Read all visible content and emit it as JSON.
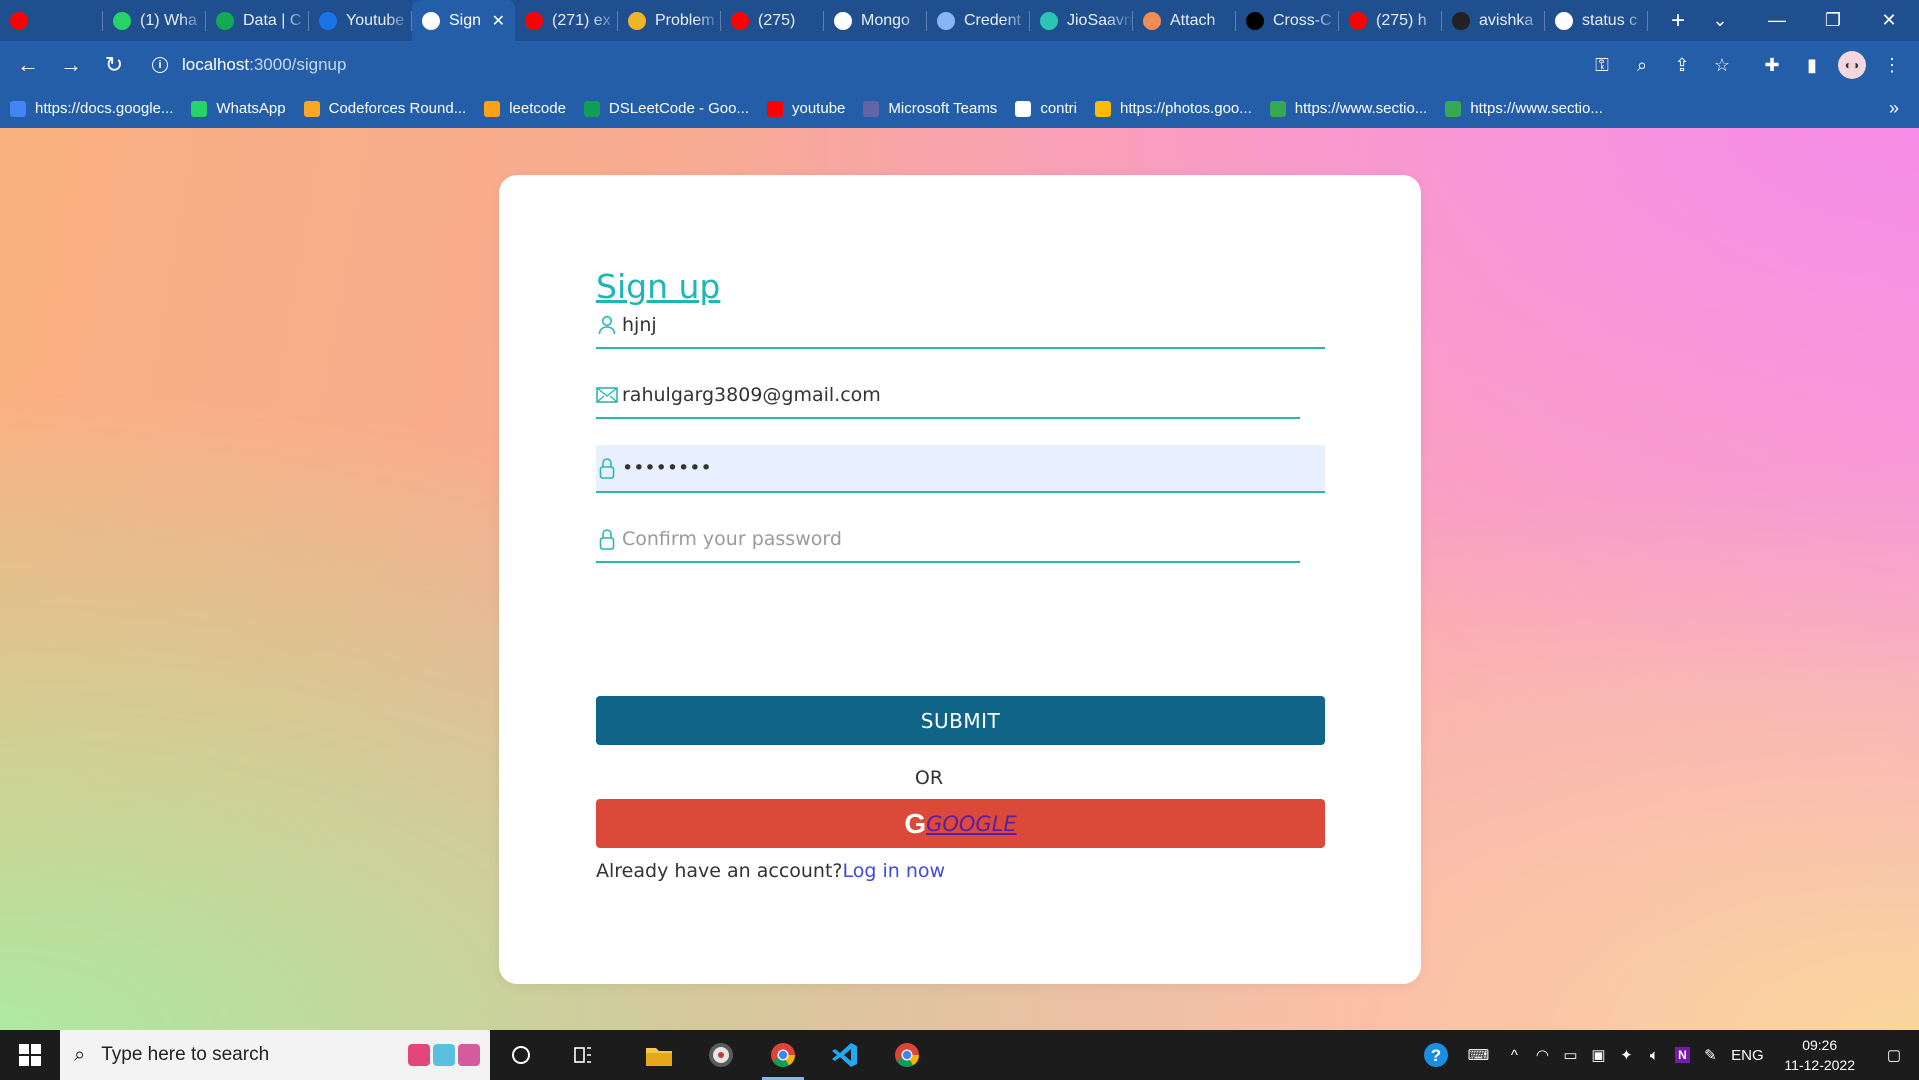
{
  "browser": {
    "tabs": [
      {
        "label": "",
        "icon": "youtube-icon",
        "color": "#ff0000"
      },
      {
        "label": "(1) Wha",
        "icon": "whatsapp-icon",
        "color": "#25d366"
      },
      {
        "label": "Data | C",
        "icon": "mongodb-icon",
        "color": "#13aa52"
      },
      {
        "label": "Youtube",
        "icon": "codeforces-icon",
        "color": "#1a73e8"
      },
      {
        "label": "Sign",
        "icon": "globe-icon",
        "color": "#ffffff",
        "active": true
      },
      {
        "label": "(271) ex",
        "icon": "youtube-icon",
        "color": "#ff0000"
      },
      {
        "label": "Problem",
        "icon": "leetcode-icon",
        "color": "#f0b429"
      },
      {
        "label": "(275)",
        "icon": "youtube-icon",
        "color": "#ff0000"
      },
      {
        "label": "Mongo",
        "icon": "mongo-m-icon",
        "color": "#ffffff"
      },
      {
        "label": "Credent",
        "icon": "api-icon",
        "color": "#8ab4f8"
      },
      {
        "label": "JioSaavn",
        "icon": "jiosaavn-icon",
        "color": "#2bc5b4"
      },
      {
        "label": "Attach",
        "icon": "attach-icon",
        "color": "#f28b54"
      },
      {
        "label": "Cross-C",
        "icon": "m-icon",
        "color": "#000000"
      },
      {
        "label": "(275) h",
        "icon": "youtube-icon",
        "color": "#ff0000"
      },
      {
        "label": "avishka",
        "icon": "github-icon",
        "color": "#222222"
      },
      {
        "label": "status c",
        "icon": "google-icon",
        "color": "#ffffff"
      }
    ],
    "url_host": "localhost",
    "url_path": ":3000/signup",
    "bookmarks": [
      {
        "label": "https://docs.google...",
        "color": "#4285f4"
      },
      {
        "label": "WhatsApp",
        "color": "#25d366"
      },
      {
        "label": "Codeforces Round...",
        "color": "#f9a825"
      },
      {
        "label": "leetcode",
        "color": "#ffa116"
      },
      {
        "label": "DSLeetCode - Goo...",
        "color": "#0f9d58"
      },
      {
        "label": "youtube",
        "color": "#ff0000"
      },
      {
        "label": "Microsoft Teams",
        "color": "#6264a7"
      },
      {
        "label": "contri",
        "color": "#ffffff"
      },
      {
        "label": "https://photos.goo...",
        "color": "#fbbc04"
      },
      {
        "label": "https://www.sectio...",
        "color": "#34a853"
      },
      {
        "label": "https://www.sectio...",
        "color": "#34a853"
      }
    ]
  },
  "form": {
    "title": "Sign up",
    "name_value": "hjnj",
    "email_value": "rahulgarg3809@gmail.com",
    "password_value": "abcdefgh",
    "confirm_placeholder": "Confirm your password",
    "submit_label": "SUBMIT",
    "or_label": "OR",
    "google_icon": "G",
    "google_label": "GOOGLE",
    "account_prompt": "Already have an account?",
    "login_link": "Log in now"
  },
  "taskbar": {
    "search_placeholder": "Type here to search",
    "language": "ENG",
    "time": "09:26",
    "date": "11-12-2022"
  },
  "colors": {
    "accent": "#1fb6b8",
    "submit": "#0f6487",
    "google": "#db4a39"
  }
}
